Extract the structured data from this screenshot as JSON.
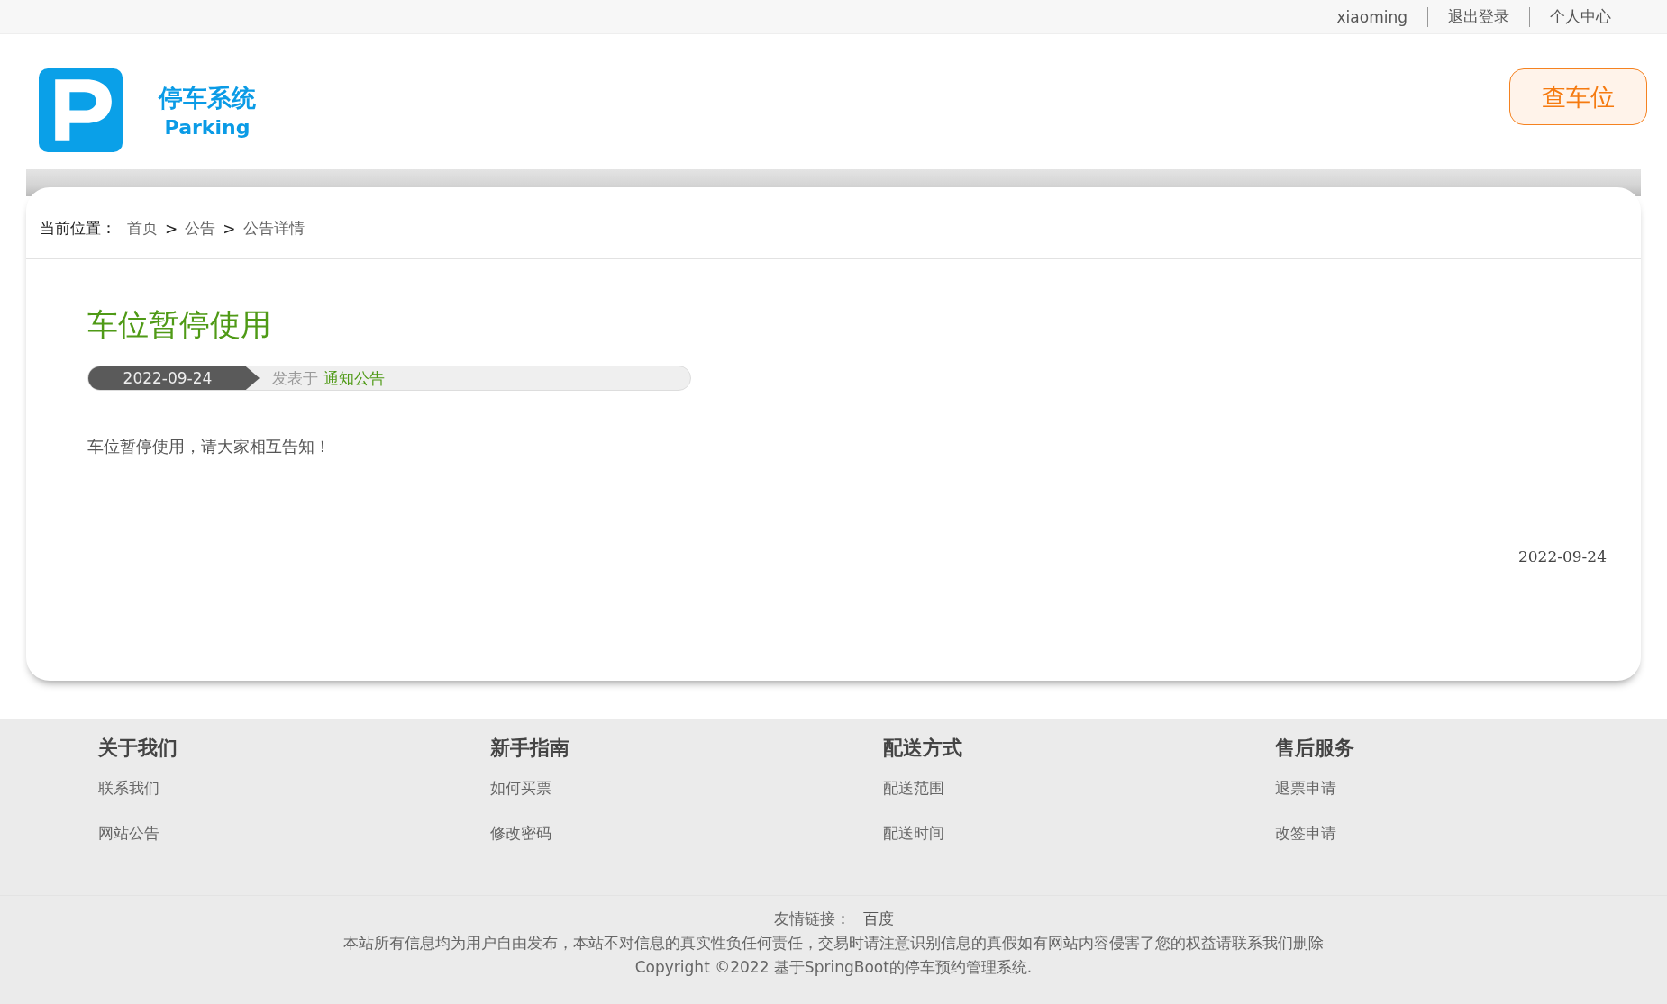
{
  "top_bar": {
    "links": [
      "xiaoming",
      "退出登录",
      "个人中心"
    ]
  },
  "header": {
    "logo_title": "停车系统",
    "logo_subtitle": "Parking",
    "button": "查车位"
  },
  "breadcrumb": {
    "label": "当前位置：",
    "items": [
      "首页",
      "公告",
      "公告详情"
    ],
    "separator": ">"
  },
  "article": {
    "title": "车位暂停使用",
    "date": "2022-09-24",
    "posted_in": "发表于",
    "category": "通知公告",
    "body": "车位暂停使用，请大家相互告知！",
    "footer_date": "2022-09-24"
  },
  "footer": {
    "columns": [
      {
        "heading": "关于我们",
        "links": [
          "联系我们",
          "网站公告"
        ]
      },
      {
        "heading": "新手指南",
        "links": [
          "如何买票",
          "修改密码"
        ]
      },
      {
        "heading": "配送方式",
        "links": [
          "配送范围",
          "配送时间"
        ]
      },
      {
        "heading": "售后服务",
        "links": [
          "退票申请",
          "改签申请"
        ]
      }
    ],
    "friend_links_label": "友情链接：",
    "friend_links": [
      "百度"
    ],
    "disclaimer": "本站所有信息均为用户自由发布，本站不对信息的真实性负任何责任，交易时请注意识别信息的真假如有网站内容侵害了您的权益请联系我们删除",
    "copyright": "Copyright ©2022 基于SpringBoot的停车预约管理系统."
  }
}
